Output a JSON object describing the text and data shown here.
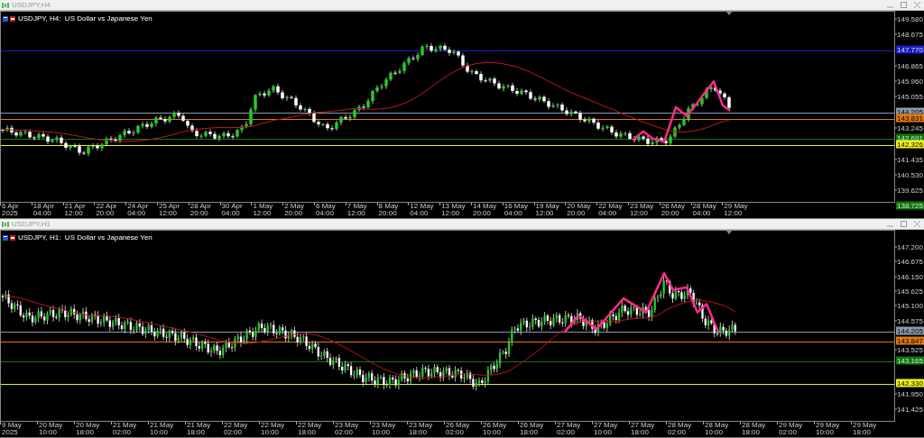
{
  "charts": [
    {
      "window_title": "USDJPY,H4",
      "legend": "USDJPY, H4:  US Dollar vs Japanese Yen",
      "price_ticks": [
        "149.580",
        "148.675",
        "146.865",
        "145.960",
        "145.055",
        "143.245",
        "141.435",
        "140.530",
        "139.625"
      ],
      "price_markers": [
        {
          "value": "147.770",
          "color": "#1c1cc8"
        },
        {
          "value": "144.205",
          "color": "#8a9aaa"
        },
        {
          "value": "143.831",
          "color": "#e07818"
        },
        {
          "value": "142.691",
          "color": "#107810"
        },
        {
          "value": "142.326",
          "color": "#f0f020"
        },
        {
          "value": "138.725",
          "color": "#107810"
        }
      ],
      "time_labels": [
        "6 Apr 2025",
        "18 Apr 04:00",
        "21 Apr 12:00",
        "22 Apr 20:00",
        "24 Apr 04:00",
        "25 Apr 12:00",
        "28 Apr 20:00",
        "30 Apr 04:00",
        "1 May 12:00",
        "2 May 20:00",
        "6 May 04:00",
        "7 May 12:00",
        "8 May 20:00",
        "12 May 04:00",
        "13 May 12:00",
        "14 May 20:00",
        "16 May 04:00",
        "19 May 12:00",
        "20 May 20:00",
        "22 May 04:00",
        "23 May 12:00",
        "26 May 20:00",
        "28 May 04:00",
        "29 May 12:00"
      ]
    },
    {
      "window_title": "USDJPY,H1",
      "legend": "USDJPY, H1:  US Dollar vs Japanese Yen",
      "price_ticks": [
        "147.200",
        "146.675",
        "146.150",
        "145.625",
        "145.100",
        "144.575",
        "143.525",
        "141.950",
        "141.425"
      ],
      "price_markers": [
        {
          "value": "144.205",
          "color": "#8a9aaa"
        },
        {
          "value": "143.847",
          "color": "#e07818"
        },
        {
          "value": "143.165",
          "color": "#107810"
        },
        {
          "value": "142.330",
          "color": "#f0f020"
        }
      ],
      "time_labels": [
        "9 May 2025",
        "20 May 10:00",
        "20 May 18:00",
        "21 May 02:00",
        "21 May 10:00",
        "21 May 18:00",
        "22 May 02:00",
        "22 May 10:00",
        "22 May 18:00",
        "23 May 02:00",
        "23 May 10:00",
        "23 May 18:00",
        "26 May 02:00",
        "26 May 10:00",
        "26 May 18:00",
        "27 May 02:00",
        "27 May 10:00",
        "27 May 18:00",
        "28 May 02:00",
        "28 May 10:00",
        "28 May 18:00",
        "29 May 02:00",
        "29 May 10:00",
        "29 May 18:00"
      ]
    }
  ]
}
